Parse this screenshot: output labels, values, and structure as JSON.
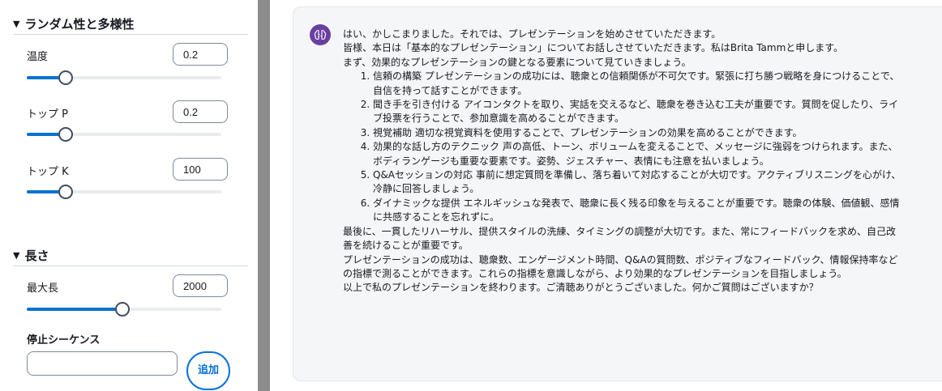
{
  "sidebar": {
    "randomness_section": {
      "title": "ランダム性と多様性"
    },
    "temperature": {
      "label": "温度",
      "value": "0.2",
      "level": 0.2
    },
    "top_p": {
      "label": "トップ P",
      "value": "0.2",
      "level": 0.2
    },
    "top_k": {
      "label": "トップ K",
      "value": "100",
      "level": 0.2
    },
    "length_section": {
      "title": "長さ"
    },
    "max_length": {
      "label": "最大長",
      "value": "2000",
      "level": 0.49
    },
    "stop_sequence": {
      "label": "停止シーケンス",
      "value": "",
      "add_label": "追加"
    }
  },
  "chat": {
    "lines": [
      "はい、かしこまりました。それでは、プレゼンテーションを始めさせていただきます。",
      "皆様、本日は「基本的なプレゼンテーション」についてお話しさせていただきます。私はBrita Tammと申します。",
      "まず、効果的なプレゼンテーションの鍵となる要素について見ていきましょう。"
    ],
    "items": [
      "信頼の構築 プレゼンテーションの成功には、聴衆との信頼関係が不可欠です。緊張に打ち勝つ戦略を身につけることで、自信を持って話すことができます。",
      "聞き手を引き付ける アイコンタクトを取り、実話を交えるなど、聴衆を巻き込む工夫が重要です。質問を促したり、ライブ投票を行うことで、参加意識を高めることができます。",
      "視覚補助 適切な視覚資料を使用することで、プレゼンテーションの効果を高めることができます。",
      "効果的な話し方のテクニック 声の高低、トーン、ボリュームを変えることで、メッセージに強弱をつけられます。また、ボディランゲージも重要な要素です。姿勢、ジェスチャー、表情にも注意を払いましょう。",
      "Q&Aセッションの対応 事前に想定質問を準備し、落ち着いて対応することが大切です。アクティブリスニングを心がけ、冷静に回答しましょう。",
      "ダイナミックな提供 エネルギッシュな発表で、聴衆に長く残る印象を与えることが重要です。聴衆の体験、価値観、感情に共感することを忘れずに。"
    ],
    "closing": [
      "最後に、一貫したリハーサル、提供スタイルの洗練、タイミングの調整が大切です。また、常にフィードバックを求め、自己改善を続けることが重要です。",
      "プレゼンテーションの成功は、聴衆数、エンゲージメント時間、Q&Aの質問数、ポジティブなフィードバック、情報保持率などの指標で測ることができます。これらの指標を意識しながら、より効果的なプレゼンテーションを目指しましょう。",
      "以上で私のプレゼンテーションを終わります。ご清聴ありがとうございました。何かご質問はございますか？"
    ]
  },
  "colors": {
    "accent": "#0972d3",
    "avatar": "#6b3fa0",
    "splitter": "#8c8c8c"
  },
  "icons": {
    "avatar": "brain-icon",
    "collapse": "caret-down-icon"
  }
}
